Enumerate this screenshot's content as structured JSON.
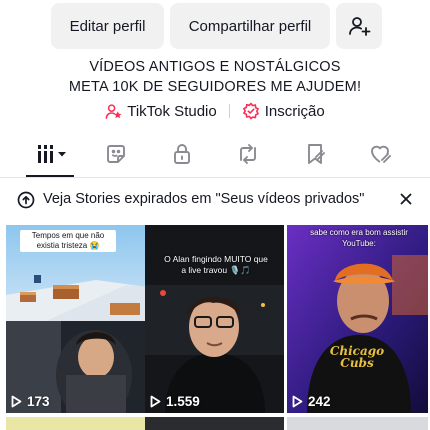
{
  "profile_buttons": {
    "edit_label": "Editar perfil",
    "share_label": "Compartilhar perfil",
    "add_friend_icon": "person-add-icon"
  },
  "bio": {
    "line1": "VÍDEOS ANTIGOS E NOSTÁLGICOS",
    "line2": "META 10K DE SEGUIDORES ME AJUDEM!"
  },
  "links": {
    "studio_label": "TikTok Studio",
    "subscription_label": "Inscrição",
    "accent_color": "#fe2c55"
  },
  "tabs": [
    {
      "name": "videos",
      "icon": "grid-bars-icon"
    },
    {
      "name": "stickers",
      "icon": "sticker-icon"
    },
    {
      "name": "private",
      "icon": "lock-icon"
    },
    {
      "name": "reposts",
      "icon": "repost-icon"
    },
    {
      "name": "favorites",
      "icon": "bookmark-icon"
    },
    {
      "name": "liked",
      "icon": "liked-heart-icon"
    }
  ],
  "banner": {
    "text": "Veja Stories expirados em \"Seus vídeos privados\"",
    "close_icon": "close-icon"
  },
  "videos": [
    {
      "caption": "Tempos em que não existia tristeza 😭",
      "views": "173"
    },
    {
      "caption": "O Alan fingindo MUITO que a live travou 🎙️🎵",
      "views": "1.559"
    },
    {
      "caption": "sabe como era bom assistir YouTube:",
      "views": "242",
      "shirt_text": "Chicago Cubs"
    }
  ]
}
